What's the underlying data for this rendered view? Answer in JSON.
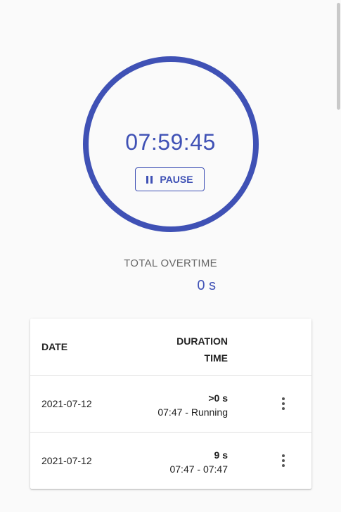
{
  "timer": {
    "time": "07:59:45",
    "pause_label": "PAUSE"
  },
  "overtime": {
    "label": "TOTAL OVERTIME",
    "value": "0 s"
  },
  "table": {
    "headers": {
      "date": "DATE",
      "duration": "DURATION",
      "time": "TIME"
    },
    "rows": [
      {
        "date": "2021-07-12",
        "duration": ">0 s",
        "time": "07:47 - Running"
      },
      {
        "date": "2021-07-12",
        "duration": "9 s",
        "time": "07:47 - 07:47"
      }
    ]
  },
  "colors": {
    "accent": "#3f51b5",
    "background": "#fafafa"
  }
}
